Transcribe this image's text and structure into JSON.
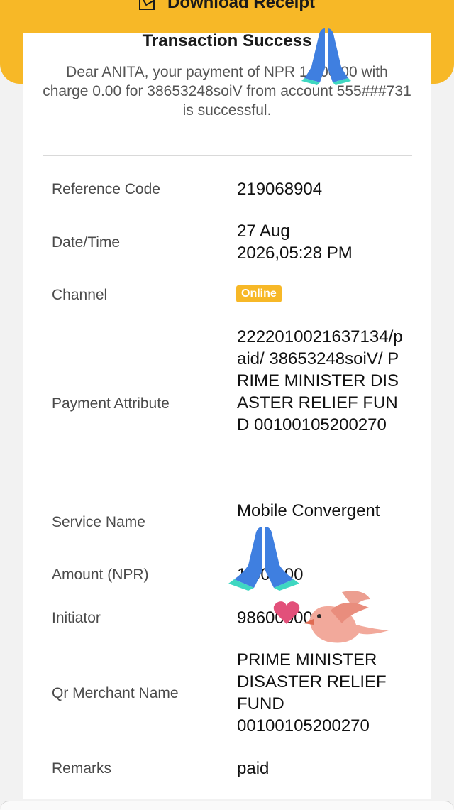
{
  "header": {
    "download_label": "Download Receipt",
    "title": "Transaction Success",
    "message": "Dear ANITA, your payment of NPR 1,000.00 with charge 0.00 for 38653248soiV from account 555###731 is successful."
  },
  "details": {
    "reference_code": {
      "label": "Reference Code",
      "value": "219068904"
    },
    "date_time": {
      "label": "Date/Time",
      "value": "27 Aug 2026,05:28 PM"
    },
    "channel": {
      "label": "Channel",
      "value": "Online"
    },
    "payment_attribute": {
      "label": "Payment Attribute",
      "value": "2222010021637134/paid/ 38653248soiV/ PRIME MINISTER DISASTER RELIEF FUND 00100105200270"
    },
    "service_name": {
      "label": "Service Name",
      "value": "Mobile Convergent"
    },
    "amount": {
      "label": "Amount (NPR)",
      "value": "1,000.00"
    },
    "initiator": {
      "label": "Initiator",
      "value": "9860000000"
    },
    "qr_merchant_name": {
      "label": "Qr Merchant Name",
      "value": "PRIME MINISTER DISASTER RELIEF FUND 00100105200270"
    },
    "remarks": {
      "label": "Remarks",
      "value": "paid"
    }
  },
  "colors": {
    "brand_yellow": "#f7b827",
    "praying_hands": "#3f7fe0",
    "bird": "#e98d7d",
    "heart": "#e2507a"
  },
  "stickers": [
    "praying-hands-icon",
    "praying-hands-icon",
    "bird-icon",
    "heart-icon"
  ]
}
